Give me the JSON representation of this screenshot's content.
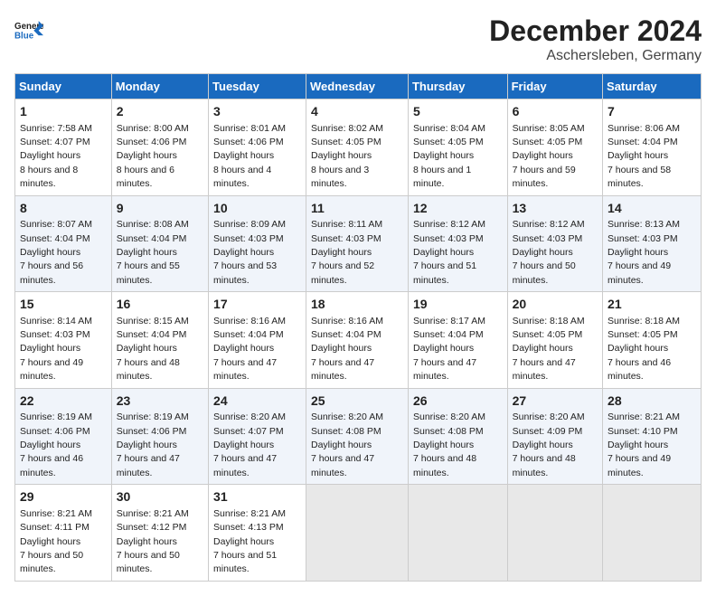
{
  "header": {
    "logo_general": "General",
    "logo_blue": "Blue",
    "title": "December 2024",
    "subtitle": "Aschersleben, Germany"
  },
  "days_of_week": [
    "Sunday",
    "Monday",
    "Tuesday",
    "Wednesday",
    "Thursday",
    "Friday",
    "Saturday"
  ],
  "weeks": [
    [
      {
        "day": "1",
        "sunrise": "7:58 AM",
        "sunset": "4:07 PM",
        "daylight": "8 hours and 8 minutes."
      },
      {
        "day": "2",
        "sunrise": "8:00 AM",
        "sunset": "4:06 PM",
        "daylight": "8 hours and 6 minutes."
      },
      {
        "day": "3",
        "sunrise": "8:01 AM",
        "sunset": "4:06 PM",
        "daylight": "8 hours and 4 minutes."
      },
      {
        "day": "4",
        "sunrise": "8:02 AM",
        "sunset": "4:05 PM",
        "daylight": "8 hours and 3 minutes."
      },
      {
        "day": "5",
        "sunrise": "8:04 AM",
        "sunset": "4:05 PM",
        "daylight": "8 hours and 1 minute."
      },
      {
        "day": "6",
        "sunrise": "8:05 AM",
        "sunset": "4:05 PM",
        "daylight": "7 hours and 59 minutes."
      },
      {
        "day": "7",
        "sunrise": "8:06 AM",
        "sunset": "4:04 PM",
        "daylight": "7 hours and 58 minutes."
      }
    ],
    [
      {
        "day": "8",
        "sunrise": "8:07 AM",
        "sunset": "4:04 PM",
        "daylight": "7 hours and 56 minutes."
      },
      {
        "day": "9",
        "sunrise": "8:08 AM",
        "sunset": "4:04 PM",
        "daylight": "7 hours and 55 minutes."
      },
      {
        "day": "10",
        "sunrise": "8:09 AM",
        "sunset": "4:03 PM",
        "daylight": "7 hours and 53 minutes."
      },
      {
        "day": "11",
        "sunrise": "8:11 AM",
        "sunset": "4:03 PM",
        "daylight": "7 hours and 52 minutes."
      },
      {
        "day": "12",
        "sunrise": "8:12 AM",
        "sunset": "4:03 PM",
        "daylight": "7 hours and 51 minutes."
      },
      {
        "day": "13",
        "sunrise": "8:12 AM",
        "sunset": "4:03 PM",
        "daylight": "7 hours and 50 minutes."
      },
      {
        "day": "14",
        "sunrise": "8:13 AM",
        "sunset": "4:03 PM",
        "daylight": "7 hours and 49 minutes."
      }
    ],
    [
      {
        "day": "15",
        "sunrise": "8:14 AM",
        "sunset": "4:03 PM",
        "daylight": "7 hours and 49 minutes."
      },
      {
        "day": "16",
        "sunrise": "8:15 AM",
        "sunset": "4:04 PM",
        "daylight": "7 hours and 48 minutes."
      },
      {
        "day": "17",
        "sunrise": "8:16 AM",
        "sunset": "4:04 PM",
        "daylight": "7 hours and 47 minutes."
      },
      {
        "day": "18",
        "sunrise": "8:16 AM",
        "sunset": "4:04 PM",
        "daylight": "7 hours and 47 minutes."
      },
      {
        "day": "19",
        "sunrise": "8:17 AM",
        "sunset": "4:04 PM",
        "daylight": "7 hours and 47 minutes."
      },
      {
        "day": "20",
        "sunrise": "8:18 AM",
        "sunset": "4:05 PM",
        "daylight": "7 hours and 47 minutes."
      },
      {
        "day": "21",
        "sunrise": "8:18 AM",
        "sunset": "4:05 PM",
        "daylight": "7 hours and 46 minutes."
      }
    ],
    [
      {
        "day": "22",
        "sunrise": "8:19 AM",
        "sunset": "4:06 PM",
        "daylight": "7 hours and 46 minutes."
      },
      {
        "day": "23",
        "sunrise": "8:19 AM",
        "sunset": "4:06 PM",
        "daylight": "7 hours and 47 minutes."
      },
      {
        "day": "24",
        "sunrise": "8:20 AM",
        "sunset": "4:07 PM",
        "daylight": "7 hours and 47 minutes."
      },
      {
        "day": "25",
        "sunrise": "8:20 AM",
        "sunset": "4:08 PM",
        "daylight": "7 hours and 47 minutes."
      },
      {
        "day": "26",
        "sunrise": "8:20 AM",
        "sunset": "4:08 PM",
        "daylight": "7 hours and 48 minutes."
      },
      {
        "day": "27",
        "sunrise": "8:20 AM",
        "sunset": "4:09 PM",
        "daylight": "7 hours and 48 minutes."
      },
      {
        "day": "28",
        "sunrise": "8:21 AM",
        "sunset": "4:10 PM",
        "daylight": "7 hours and 49 minutes."
      }
    ],
    [
      {
        "day": "29",
        "sunrise": "8:21 AM",
        "sunset": "4:11 PM",
        "daylight": "7 hours and 50 minutes."
      },
      {
        "day": "30",
        "sunrise": "8:21 AM",
        "sunset": "4:12 PM",
        "daylight": "7 hours and 50 minutes."
      },
      {
        "day": "31",
        "sunrise": "8:21 AM",
        "sunset": "4:13 PM",
        "daylight": "7 hours and 51 minutes."
      },
      null,
      null,
      null,
      null
    ]
  ]
}
